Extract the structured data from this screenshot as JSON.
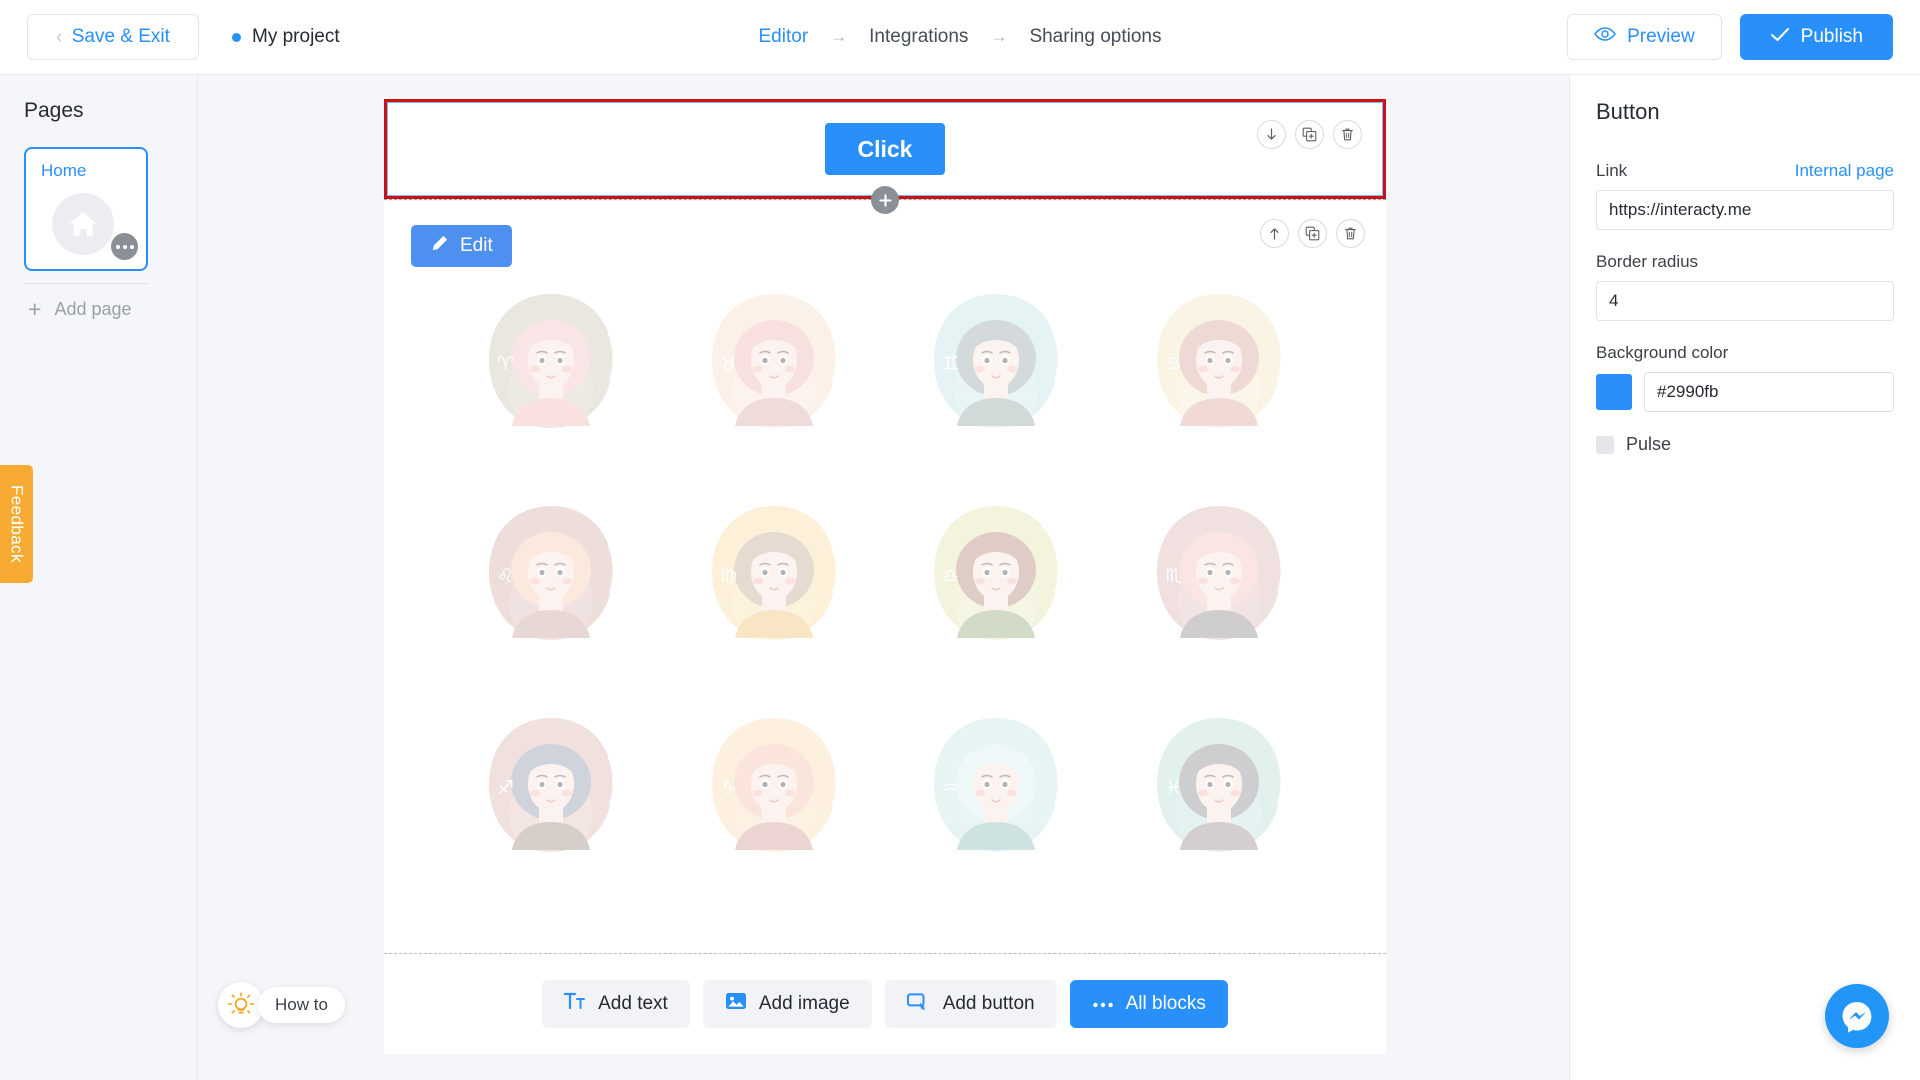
{
  "topbar": {
    "save_exit": "Save & Exit",
    "project_name": "My project",
    "breadcrumb": [
      {
        "label": "Editor",
        "active": true
      },
      {
        "label": "Integrations",
        "active": false
      },
      {
        "label": "Sharing options",
        "active": false
      }
    ],
    "arrow": "→",
    "preview": "Preview",
    "publish": "Publish",
    "icons": {
      "back": "chevron-left-icon",
      "eye": "eye-icon",
      "check": "check-icon"
    }
  },
  "sidebar": {
    "title": "Pages",
    "pages": [
      {
        "label": "Home",
        "thumb": "home-icon",
        "selected": true
      }
    ],
    "add_page": "Add page",
    "feedback": "Feedback"
  },
  "howto": {
    "label": "How to",
    "icon": "lightbulb-icon"
  },
  "canvas": {
    "block_button": {
      "label": "Click",
      "selected": true,
      "tools": [
        {
          "name": "move-down-icon",
          "glyph": "↓"
        },
        {
          "name": "duplicate-icon",
          "glyph": "copy"
        },
        {
          "name": "delete-icon",
          "glyph": "trash"
        }
      ]
    },
    "add_block_divider": {
      "name": "add-block-button",
      "glyph": "+"
    },
    "block_images": {
      "edit_label": "Edit",
      "tools": [
        {
          "name": "move-up-icon",
          "glyph": "↑"
        },
        {
          "name": "duplicate-icon",
          "glyph": "copy"
        },
        {
          "name": "delete-icon",
          "glyph": "trash"
        }
      ],
      "zodiac": [
        {
          "sign": "Aries",
          "glyph": "♈",
          "bg": "#cdc8b4",
          "hair": "#f3c3c5",
          "skin": "#fae4dc",
          "dress": "#f3b9b5",
          "hair_style": "big-curls"
        },
        {
          "sign": "Taurus",
          "glyph": "♉",
          "bg": "#fadfcb",
          "hair": "#f0b7b3",
          "skin": "#fae4dc",
          "dress": "#ddabaa",
          "hair_style": "horns"
        },
        {
          "sign": "Gemini",
          "glyph": "♊",
          "bg": "#c5e4e6",
          "hair": "#9aa8ab",
          "skin": "#fae7de",
          "dress": "#93a8a7",
          "hair_style": "bob"
        },
        {
          "sign": "Cancer",
          "glyph": "♋",
          "bg": "#f4e7c3",
          "hair": "#d9a59c",
          "skin": "#fae4dc",
          "dress": "#e0a99f",
          "hair_style": "curly"
        },
        {
          "sign": "Leo",
          "glyph": "♌",
          "bg": "#d6b2ae",
          "hair": "#f6cdb3",
          "skin": "#fae4dc",
          "dress": "#c8a19d",
          "hair_style": "mane"
        },
        {
          "sign": "Virgo",
          "glyph": "♍",
          "bg": "#f8dfa3",
          "hair": "#c5ac94",
          "skin": "#fae4dc",
          "dress": "#edc372",
          "hair_style": "long-straight"
        },
        {
          "sign": "Libra",
          "glyph": "♎",
          "bg": "#e5e6b3",
          "hair": "#b4877a",
          "skin": "#fae4dc",
          "dress": "#93ab7c",
          "hair_style": "short-curls"
        },
        {
          "sign": "Scorpio",
          "glyph": "♏",
          "bg": "#dcb6b6",
          "hair": "#f4c2bb",
          "skin": "#fae4dc",
          "dress": "#8e8c8a",
          "hair_style": "swept"
        },
        {
          "sign": "Sagittarius",
          "glyph": "♐",
          "bg": "#ddb9b2",
          "hair": "#8f97ad",
          "skin": "#fae4dc",
          "dress": "#a08b81",
          "hair_style": "bob-wave"
        },
        {
          "sign": "Capricorn",
          "glyph": "♑",
          "bg": "#fbdcb2",
          "hair": "#f5bfad",
          "skin": "#fae4dc",
          "dress": "#d49a96",
          "hair_style": "horn-curls"
        },
        {
          "sign": "Aquarius",
          "glyph": "♒",
          "bg": "#c4e6e4",
          "hair": "#d8f0ef",
          "skin": "#fae4dc",
          "dress": "#8cbcbb",
          "hair_style": "long-wavy"
        },
        {
          "sign": "Pisces",
          "glyph": "♓",
          "bg": "#bcdcd9",
          "hair": "#8b8b94",
          "skin": "#fae4dc",
          "dress": "#9a8f8d",
          "hair_style": "bun"
        }
      ]
    },
    "add_buttons": [
      {
        "label": "Add text",
        "icon": "text-icon",
        "primary": false
      },
      {
        "label": "Add image",
        "icon": "image-icon",
        "primary": false
      },
      {
        "label": "Add button",
        "icon": "button-icon",
        "primary": false
      },
      {
        "label": "All blocks",
        "icon": "ellipsis-icon",
        "primary": true
      }
    ]
  },
  "rightpanel": {
    "title": "Button",
    "link_label": "Link",
    "internal_page": "Internal page",
    "link_value": "https://interacty.me",
    "border_radius_label": "Border radius",
    "border_radius_value": "4",
    "background_label": "Background color",
    "background_value": "#2990fb",
    "pulse_label": "Pulse"
  },
  "messenger": {
    "name": "messenger-chat-button"
  },
  "colors": {
    "accent": "#2990fb",
    "selection": "#c81313",
    "feedback": "#f7ab32"
  }
}
